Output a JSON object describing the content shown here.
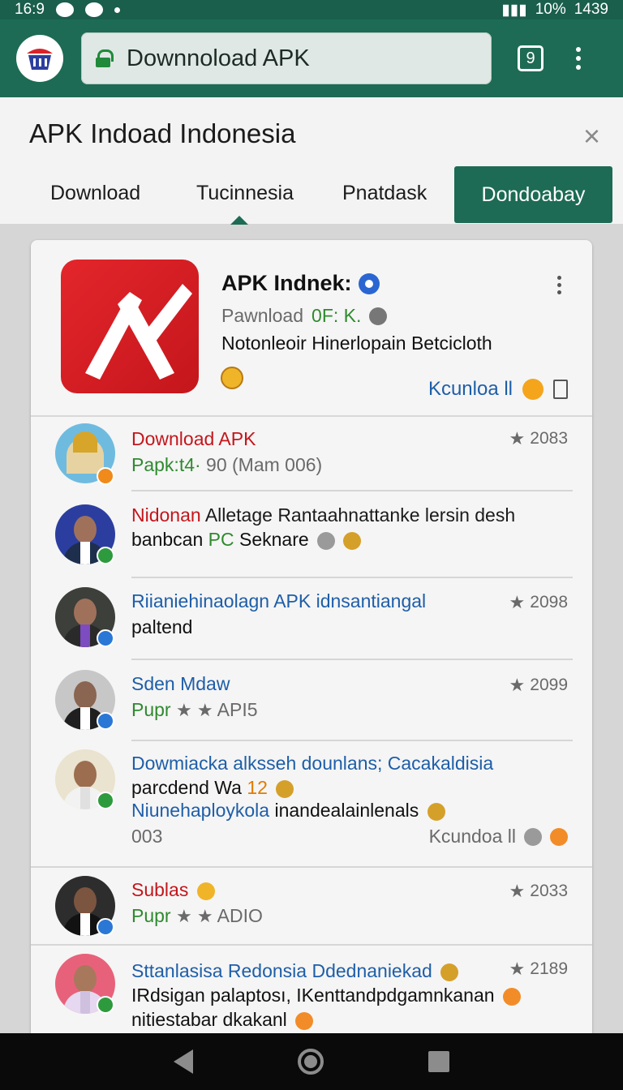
{
  "status_bar": {
    "time": "16:9",
    "battery": "10%",
    "clock_right": "1439"
  },
  "browser": {
    "url": "Downnoload APK",
    "tabs_count": "9"
  },
  "header": {
    "title": "APK Indoad Indonesia",
    "close_symbol": "×",
    "tabs": [
      "Download",
      "Tucinnesia",
      "Pnatdask",
      "Dondoabay"
    ]
  },
  "app": {
    "name": "APK Indnek:",
    "meta_prefix": "Pawnload",
    "meta_value": "0F: K.",
    "description": "Notonleoir Hinerlopain Betcicloth",
    "action_label": "Kcunloa ll"
  },
  "comments": [
    {
      "title": "Download APK",
      "sub": "Papk:t4·",
      "sub_rest": "90 (Mam 006)",
      "rating": "2083",
      "badge": "orange"
    },
    {
      "title_red": "Nidonan",
      "title_rest": "Alletage Rantaahnattanke lersin desh",
      "sub": "banbcan",
      "sub_green": "PC",
      "sub_rest": "Seknare",
      "badge": "green"
    },
    {
      "title": "Riianiehinaolagn APK idnsantiangal",
      "sub": "paltend",
      "rating": "2098",
      "badge": "blue"
    },
    {
      "title": "Sden Mdaw",
      "sub_green": "Pupr",
      "sub_rest": "API5",
      "rating": "2099",
      "badge": "blue"
    },
    {
      "title": "Dowmiacka alksseh dounlans; Cacakaldisia",
      "sub": "parcdend Wa",
      "sub_orange": "12",
      "sub2": "Niunehaploykola",
      "sub2_rest": "inandealainlenals",
      "count": "003",
      "action_label": "Kcundoa ll",
      "badge": "green"
    },
    {
      "title": "Sublas",
      "sub_green": "Pupr",
      "sub_rest": "ADIO",
      "rating": "2033",
      "badge": "blue"
    },
    {
      "title": "Sttanlasisa Redonsia Ddednaniekad",
      "sub": "IRdsigan palaptosı, IKenttandpdgamnkanan",
      "sub2": "nitiestabar dkakanl",
      "rating": "2189",
      "badge": "green"
    }
  ],
  "icons": {
    "app_logo": "shopping-basket-icon",
    "lock": "lock-icon",
    "tabs": "tabs-icon",
    "more": "more-vert-icon",
    "star": "star-icon",
    "verified": "verified-icon"
  },
  "colors": {
    "primary": "#1d6b54",
    "accent_red": "#c4161c",
    "link_blue": "#1e5ea8",
    "green": "#2f8a2f"
  }
}
